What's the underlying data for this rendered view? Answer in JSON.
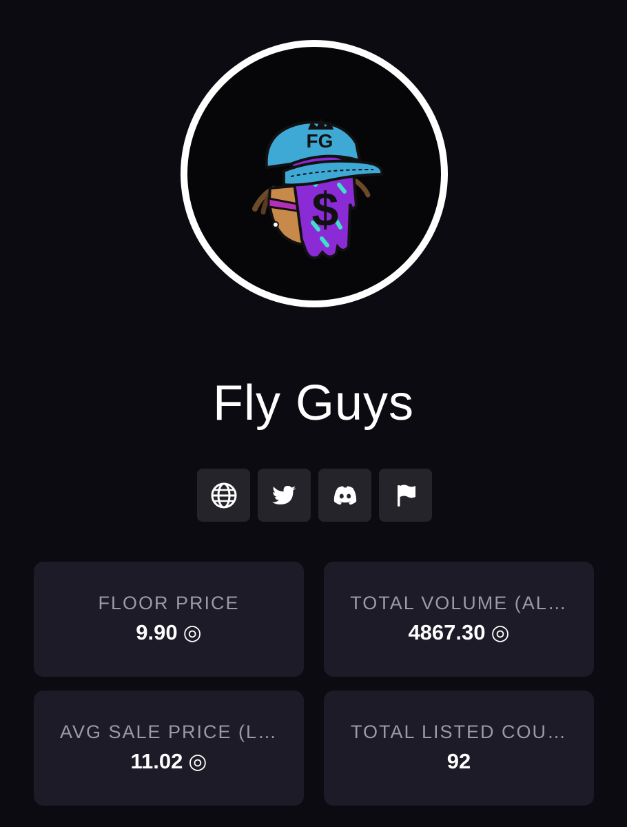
{
  "collection": {
    "name": "Fly Guys",
    "avatar_icon": "fly-guys-logo",
    "avatar_badge_text": "FG"
  },
  "social_links": [
    {
      "name": "website",
      "icon": "globe-icon"
    },
    {
      "name": "twitter",
      "icon": "twitter-icon"
    },
    {
      "name": "discord",
      "icon": "discord-icon"
    },
    {
      "name": "report",
      "icon": "flag-icon"
    }
  ],
  "stats": [
    {
      "label": "FLOOR PRICE",
      "value": "9.90",
      "currency_symbol": "◎"
    },
    {
      "label": "TOTAL VOLUME (AL…",
      "value": "4867.30",
      "currency_symbol": "◎"
    },
    {
      "label": "AVG SALE PRICE (L…",
      "value": "11.02",
      "currency_symbol": "◎"
    },
    {
      "label": "TOTAL LISTED COU…",
      "value": "92",
      "currency_symbol": ""
    }
  ],
  "colors": {
    "background": "#0c0b12",
    "card": "#1c1b27",
    "button": "#25242b",
    "label": "#9c9aa9",
    "cap_blue": "#3fa9d6",
    "face_purple": "#8a2bd6",
    "accent_teal": "#3ee0c8"
  }
}
